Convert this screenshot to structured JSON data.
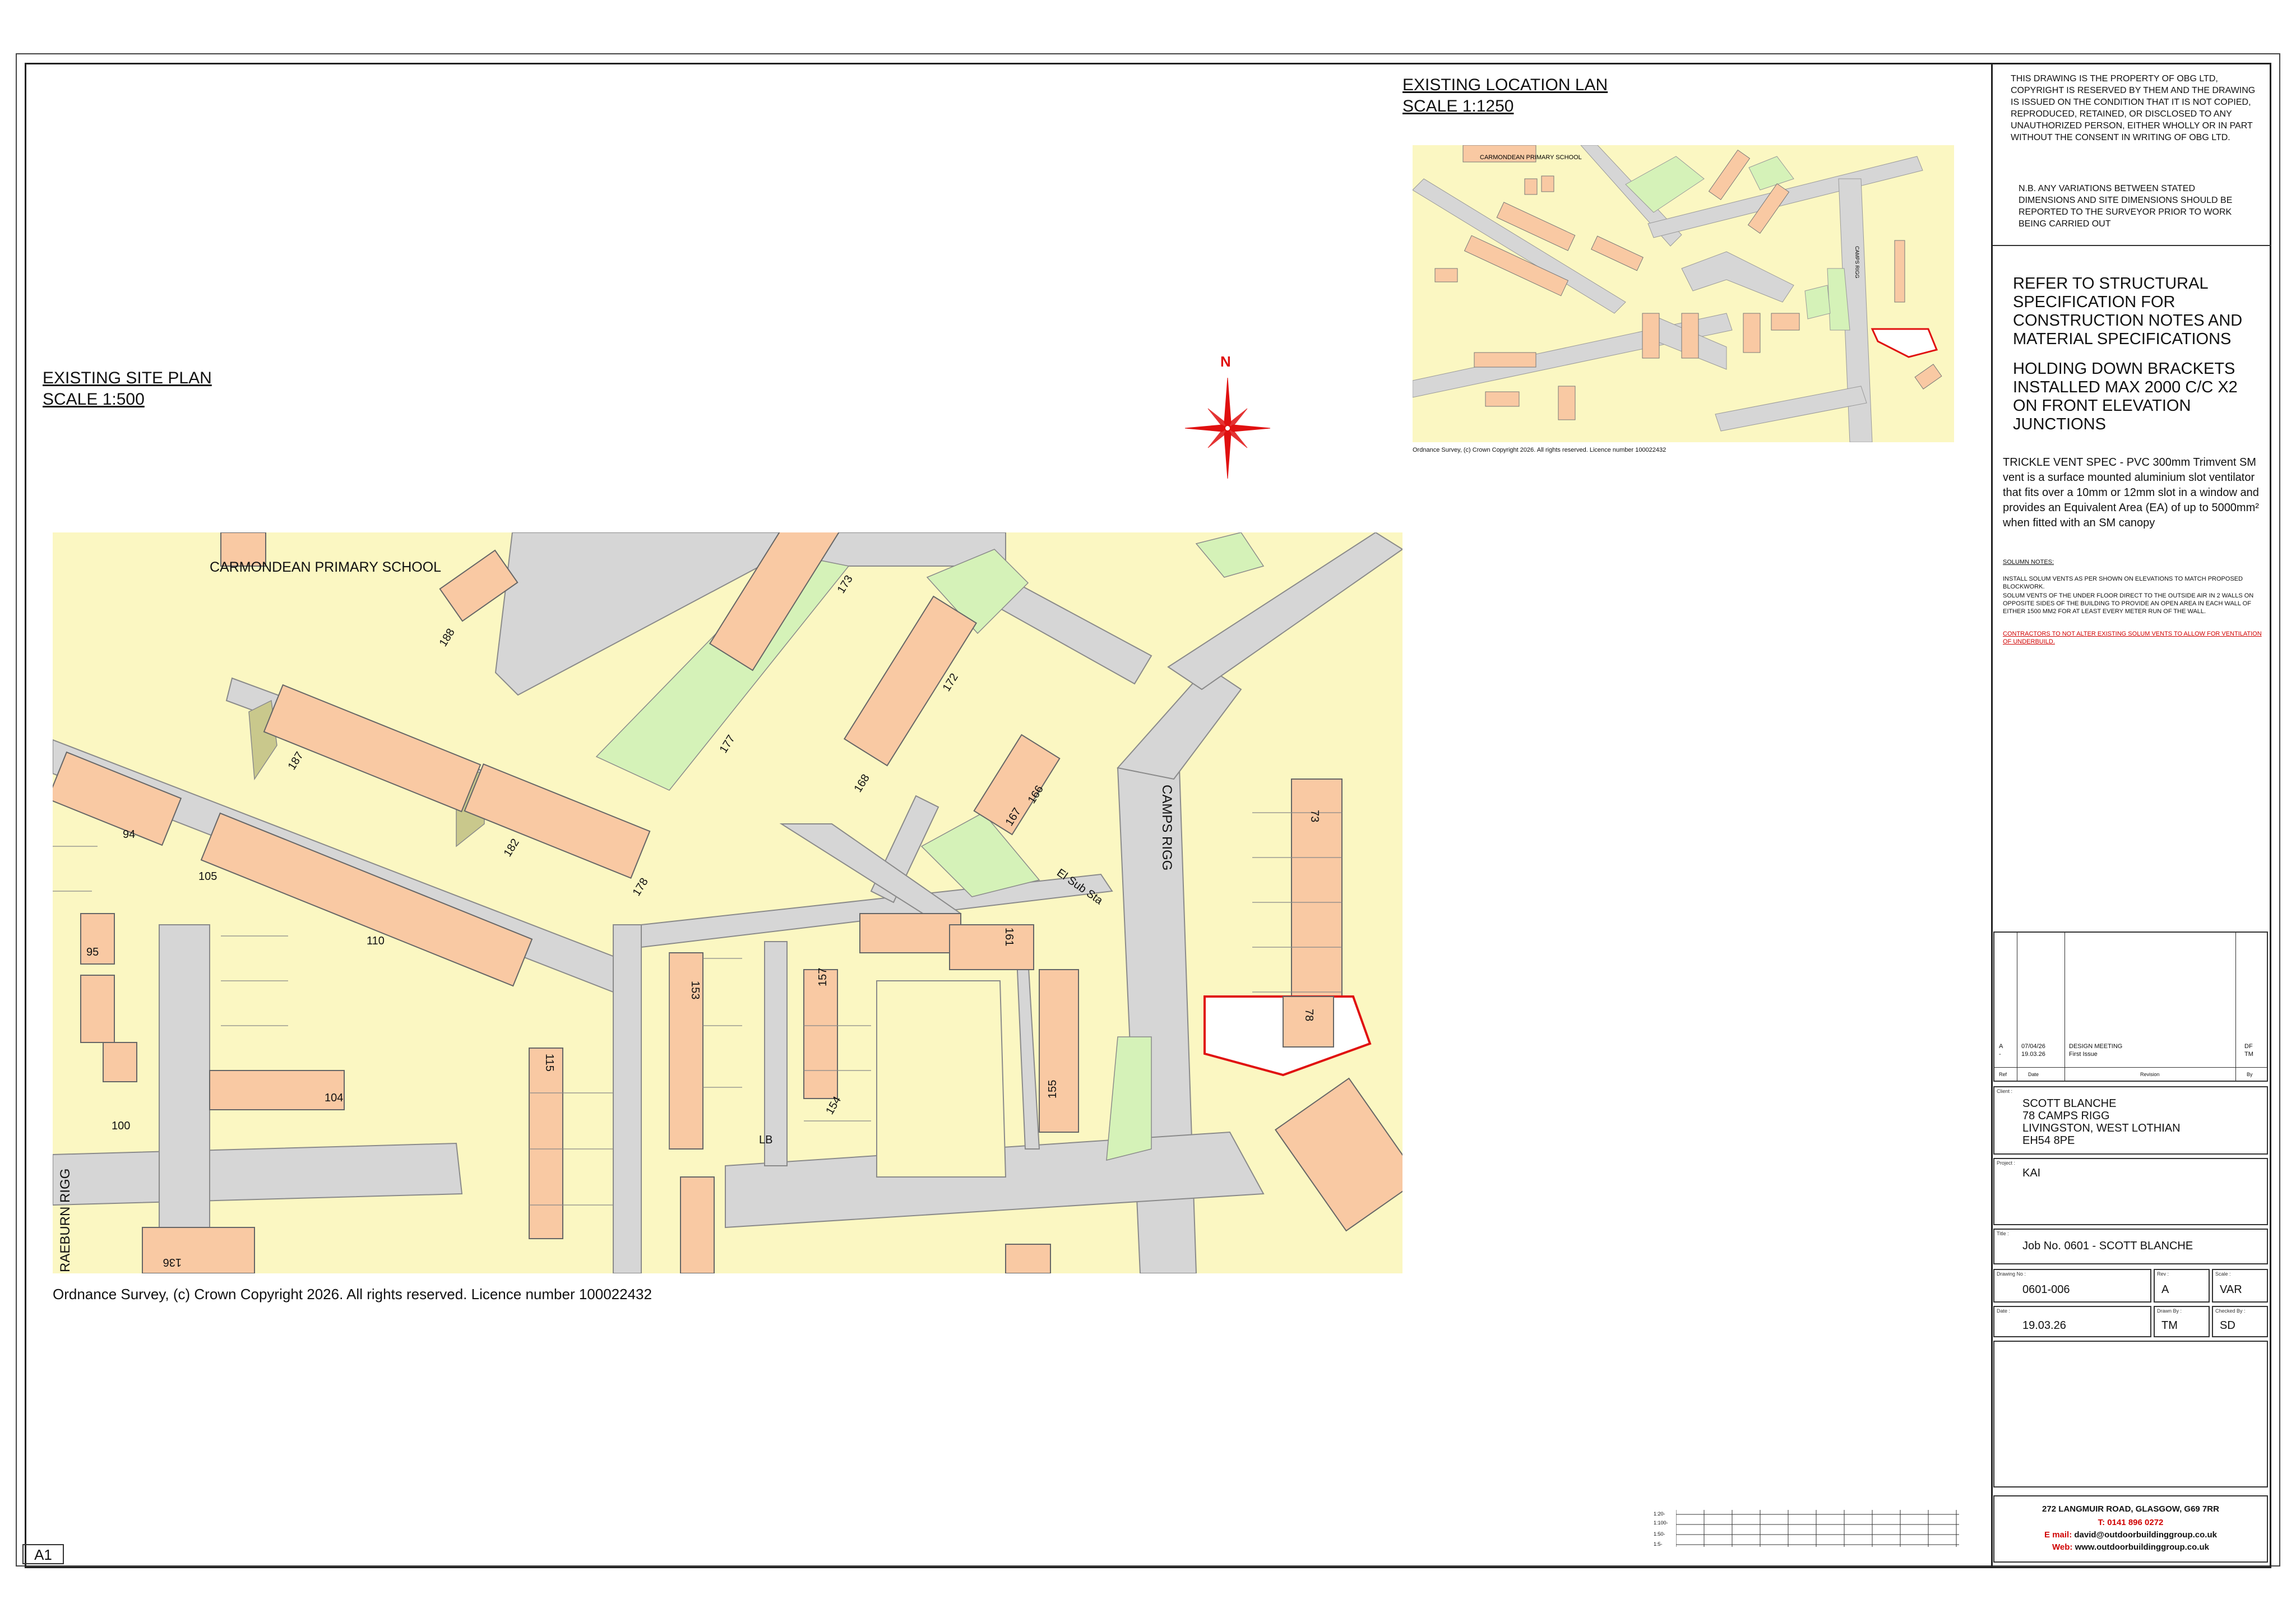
{
  "site_plan": {
    "title": "EXISTING SITE PLAN",
    "scale": "SCALE 1:500",
    "copyright": "Ordnance Survey, (c) Crown Copyright 2026. All rights reserved. Licence number 100022432",
    "labels": {
      "school": "CARMONDEAN PRIMARY SCHOOL",
      "camps_rigg": "CAMPS RIGG",
      "raeburn_rigg": "RAEBURN RIGG",
      "el_sub_sta": "El Sub Sta",
      "lb": "LB"
    },
    "house_numbers": [
      "173",
      "188",
      "187",
      "94",
      "105",
      "110",
      "95",
      "100",
      "104",
      "182",
      "178",
      "177",
      "172",
      "168",
      "167",
      "166",
      "153",
      "157",
      "161",
      "115",
      "154",
      "155",
      "136",
      "73",
      "78"
    ]
  },
  "north_label": "N",
  "location_plan": {
    "title": "EXISTING LOCATION LAN",
    "scale": "SCALE 1:1250",
    "school": "CARMONDEAN PRIMARY SCHOOL",
    "road": "CAMPS RIGG",
    "copyright": "Ordnance Survey, (c) Crown Copyright 2026. All rights reserved. Licence number 100022432"
  },
  "panel": {
    "notice": "THIS DRAWING IS THE PROPERTY OF OBG LTD, COPYRIGHT IS RESERVED BY THEM AND THE DRAWING IS ISSUED ON THE CONDITION THAT IT IS NOT COPIED, REPRODUCED, RETAINED, OR DISCLOSED TO ANY UNAUTHORIZED PERSON, EITHER WHOLLY OR IN PART WITHOUT THE CONSENT IN WRITING OF OBG LTD.",
    "nb": "N.B. ANY VARIATIONS BETWEEN STATED DIMENSIONS AND SITE DIMENSIONS SHOULD BE REPORTED TO THE SURVEYOR PRIOR TO WORK BEING CARRIED OUT",
    "structural": "REFER TO STRUCTURAL SPECIFICATION FOR CONSTRUCTION NOTES AND MATERIAL SPECIFICATIONS",
    "brackets": "HOLDING DOWN BRACKETS INSTALLED MAX 2000 C/C X2 ON FRONT ELEVATION JUNCTIONS",
    "trickle": "TRICKLE VENT SPEC - PVC 300mm Trimvent SM vent is a surface mounted aluminium slot ventilator that fits over a 10mm or 12mm slot in a window and provides an Equivalent Area (EA) of up to 5000mm² when fitted with an SM canopy",
    "solum_title": "SOLUMN NOTES:",
    "solum_1": "INSTALL SOLUM VENTS AS PER SHOWN ON ELEVATIONS TO MATCH PROPOSED BLOCKWORK.",
    "solum_2": "SOLUM VENTS OF THE UNDER FLOOR DIRECT TO THE OUTSIDE AIR IN 2 WALLS ON OPPOSITE SIDES OF THE BUILDING TO PROVIDE AN OPEN AREA IN EACH WALL OF EITHER 1500 MM2 FOR AT LEAST EVERY METER RUN OF THE WALL.",
    "solum_red": "CONTRACTORS TO NOT ALTER EXISTING SOLUM VENTS TO ALLOW FOR VENTILATION OF UNDERBUILD."
  },
  "revisions": {
    "headers": {
      "ref": "Ref",
      "date": "Date",
      "revision": "Revision",
      "by": "By"
    },
    "row": {
      "ref_a": "A",
      "ref_b": "-",
      "date_a": "07/04/26",
      "date_b": "19.03.26",
      "rev_a": "DESIGN MEETING",
      "rev_b": "First Issue",
      "by_a": "DF",
      "by_b": "TM"
    }
  },
  "title_block": {
    "client_label": "Client :",
    "client_lines": [
      "SCOTT BLANCHE",
      "78 CAMPS RIGG",
      "LIVINGSTON, WEST LOTHIAN",
      "EH54 8PE"
    ],
    "project_label": "Project :",
    "project": "KAI",
    "title_label": "Title :",
    "title": "Job No. 0601 - SCOTT BLANCHE",
    "drawing_no_label": "Drawing No :",
    "drawing_no": "0601-006",
    "rev_label": "Rev :",
    "rev": "A",
    "scale_label": "Scale :",
    "scale": "VAR",
    "date_label": "Date :",
    "date": "19.03.26",
    "drawn_label": "Drawn By :",
    "drawn": "TM",
    "checked_label": "Checked By :",
    "checked": "SD"
  },
  "company": {
    "address": "272 LANGMUIR ROAD, GLASGOW, G69 7RR",
    "tel_label": "T:",
    "tel": "0141 896 0272",
    "email_label": "E mail:",
    "email": "david@outdoorbuildinggroup.co.uk",
    "web_label": "Web:",
    "web": "www.outdoorbuildinggroup.co.uk"
  },
  "scale_bar": {
    "rows": [
      "1:20-",
      "1:100-",
      "1:50-",
      "1:5-"
    ]
  },
  "sheet_size": "A1",
  "colors": {
    "plot": "#fbf7c2",
    "house": "#f9c9a3",
    "road": "#d6d6d6",
    "green": "#d5f2b8",
    "red": "#e01010"
  }
}
